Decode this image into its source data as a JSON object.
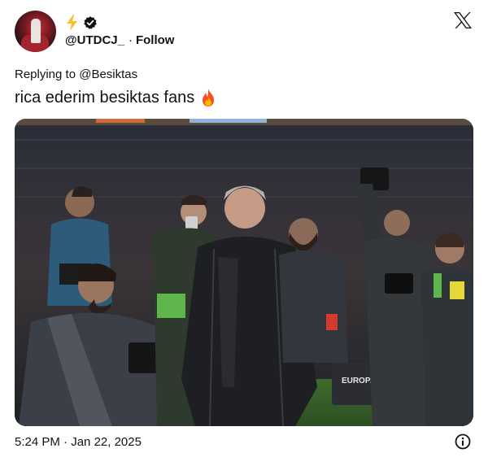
{
  "user": {
    "handle": "@UTDCJ_",
    "separator": "·",
    "follow_label": "Follow",
    "badges": [
      "lightning-bolt-icon",
      "verified-badge-icon"
    ]
  },
  "reply": {
    "text": "Replying to @Besiktas"
  },
  "tweet": {
    "text": "rica ederim besiktas fans",
    "emoji": "fire-emoji"
  },
  "media": {
    "banner_text": "EUROPA LEAGUE"
  },
  "footer": {
    "time": "5:24 PM",
    "separator": "·",
    "date": "Jan 22, 2025"
  },
  "icons": [
    "x-logo-icon",
    "info-icon"
  ],
  "colors": {
    "text": "#0f1419",
    "bolt": "#f7c12d",
    "background": "#ffffff"
  }
}
